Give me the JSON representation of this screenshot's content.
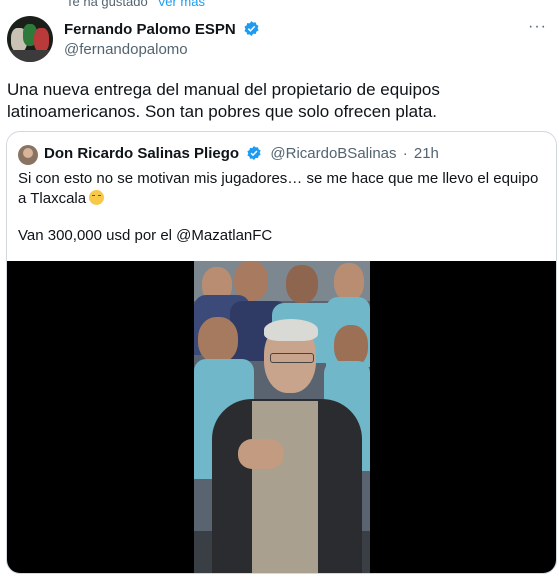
{
  "context_bar": {
    "text": "Te ha gustado",
    "link": "Ver más"
  },
  "tweet": {
    "author_name": "Fernando Palomo ESPN",
    "author_handle": "@fernandopalomo",
    "text": "Una nueva entrega del manual del propietario de equipos latinoamericanos. Son tan pobres que solo ofrecen plata.",
    "more_icon": "···"
  },
  "quote": {
    "author_name": "Don Ricardo Salinas Pliego",
    "author_handle": "@RicardoBSalinas",
    "separator": "·",
    "time": "21h",
    "text_line1": "Si con esto no se motivan mis jugadores… se me hace que me llevo el equipo a Tlaxcala",
    "text_line2": "Van 300,000 usd por el @MazatlanFC"
  },
  "colors": {
    "accent": "#1d9bf0",
    "secondary_text": "#536471",
    "border": "#cfd9de"
  },
  "icons": {
    "verified": "verified-badge-icon",
    "more": "more-horizontal-icon",
    "emoji": "relieved-face-emoji"
  }
}
